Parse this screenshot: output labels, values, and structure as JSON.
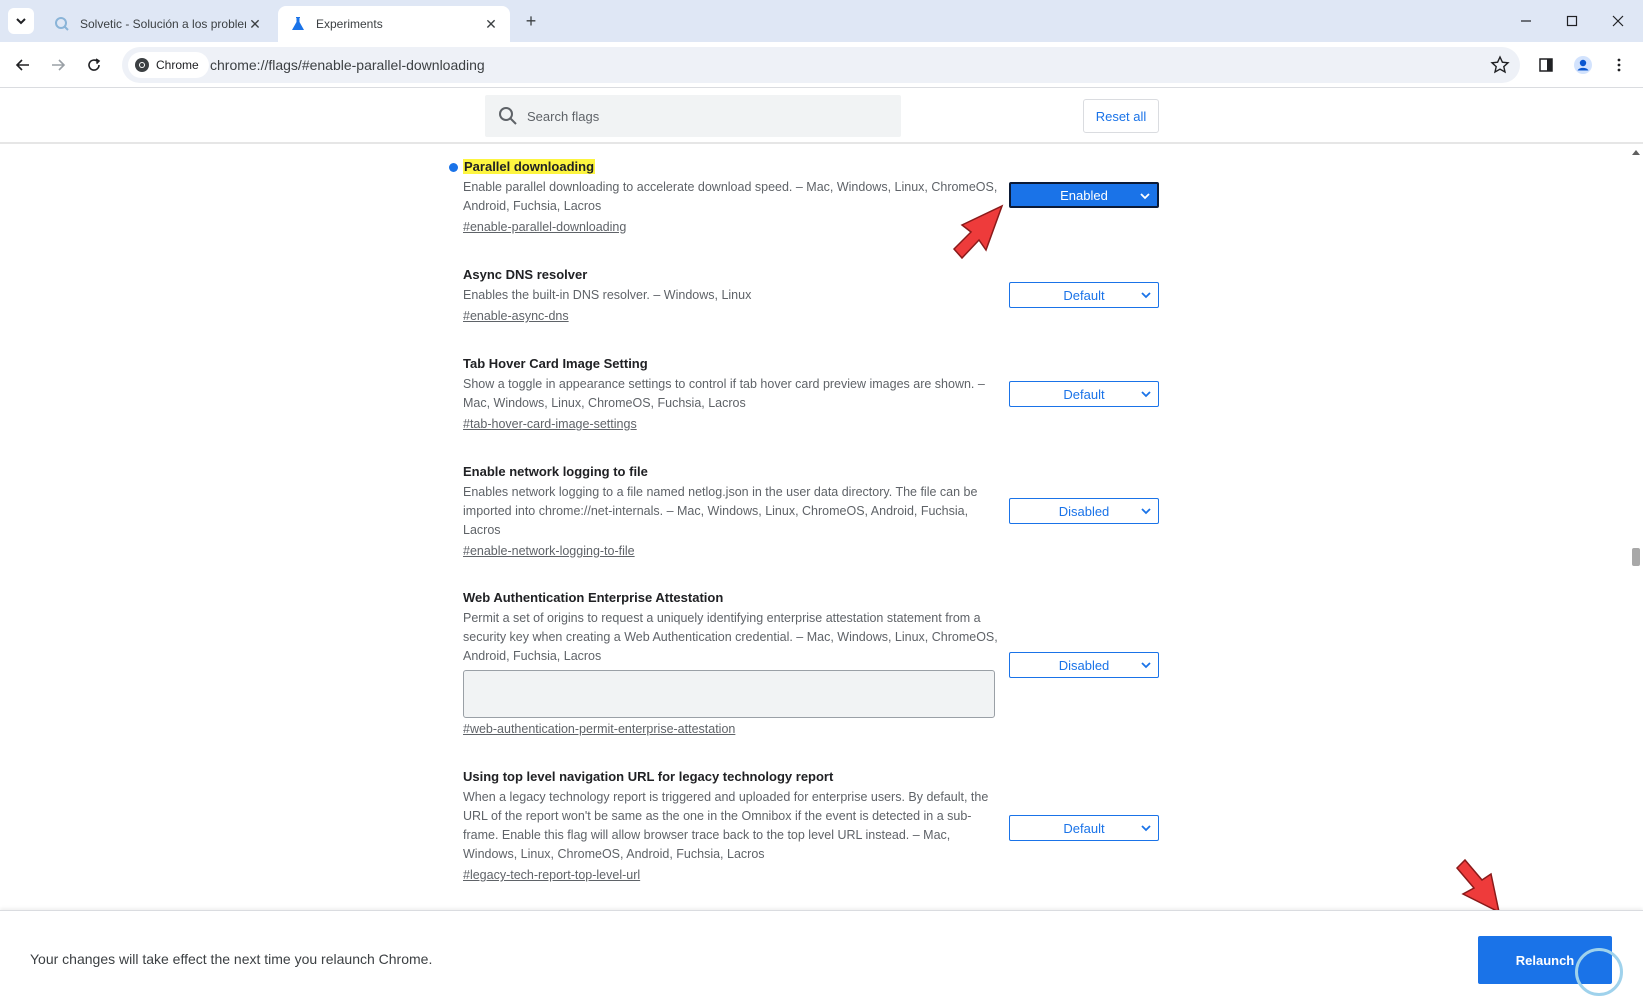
{
  "browser": {
    "tabs": [
      {
        "title": "Solvetic - Solución a los problem",
        "active": false
      },
      {
        "title": "Experiments",
        "active": true
      }
    ],
    "new_tab_label": "+",
    "chip_label": "Chrome",
    "url": "chrome://flags/#enable-parallel-downloading"
  },
  "flags_page": {
    "search_placeholder": "Search flags",
    "reset_all_label": "Reset all",
    "flags": [
      {
        "name": "Parallel downloading",
        "description": "Enable parallel downloading to accelerate download speed. – Mac, Windows, Linux, ChromeOS, Android, Fuchsia, Lacros",
        "link": "#enable-parallel-downloading",
        "value": "Enabled",
        "modified": true
      },
      {
        "name": "Async DNS resolver",
        "description": "Enables the built-in DNS resolver. – Windows, Linux",
        "link": "#enable-async-dns",
        "value": "Default"
      },
      {
        "name": "Tab Hover Card Image Setting",
        "description": "Show a toggle in appearance settings to control if tab hover card preview images are shown. – Mac, Windows, Linux, ChromeOS, Fuchsia, Lacros",
        "link": "#tab-hover-card-image-settings",
        "value": "Default"
      },
      {
        "name": "Enable network logging to file",
        "description": "Enables network logging to a file named netlog.json in the user data directory. The file can be imported into chrome://net-internals. – Mac, Windows, Linux, ChromeOS, Android, Fuchsia, Lacros",
        "link": "#enable-network-logging-to-file",
        "value": "Disabled"
      },
      {
        "name": "Web Authentication Enterprise Attestation",
        "description": "Permit a set of origins to request a uniquely identifying enterprise attestation statement from a security key when creating a Web Authentication credential. – Mac, Windows, Linux, ChromeOS, Android, Fuchsia, Lacros",
        "link": "#web-authentication-permit-enterprise-attestation",
        "value": "Disabled"
      },
      {
        "name": "Using top level navigation URL for legacy technology report",
        "description": "When a legacy technology report is triggered and uploaded for enterprise users. By default, the URL of the report won't be same as the one in the Omnibox if the event is detected in a sub-frame. Enable this flag will allow browser trace back to the top level URL instead. – Mac, Windows, Linux, ChromeOS, Android, Fuchsia, Lacros",
        "link": "#legacy-tech-report-top-level-url",
        "value": "Default"
      }
    ],
    "footer_message": "Your changes will take effect the next time you relaunch Chrome.",
    "relaunch_label": "Relaunch"
  },
  "colors": {
    "accent": "#1a73e8",
    "highlight": "#fdf540",
    "annotation_arrow": "#ee3b3b"
  }
}
